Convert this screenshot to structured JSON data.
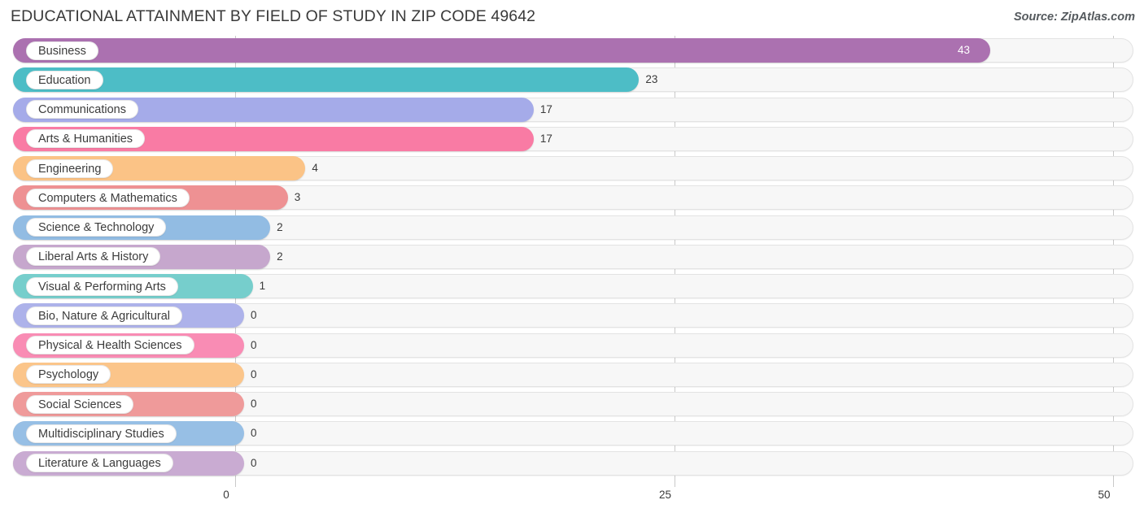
{
  "header": {
    "title": "EDUCATIONAL ATTAINMENT BY FIELD OF STUDY IN ZIP CODE 49642",
    "source": "Source: ZipAtlas.com"
  },
  "chart_data": {
    "type": "bar",
    "orientation": "horizontal",
    "title": "EDUCATIONAL ATTAINMENT BY FIELD OF STUDY IN ZIP CODE 49642",
    "xlabel": "",
    "ylabel": "",
    "xlim": [
      0,
      50
    ],
    "grid": true,
    "gridlines_at": [
      0,
      25,
      50
    ],
    "tick_labels": [
      "0",
      "25",
      "50"
    ],
    "legend": "none",
    "categories": [
      "Business",
      "Education",
      "Communications",
      "Arts & Humanities",
      "Engineering",
      "Computers & Mathematics",
      "Science & Technology",
      "Liberal Arts & History",
      "Visual & Performing Arts",
      "Bio, Nature & Agricultural",
      "Physical & Health Sciences",
      "Psychology",
      "Social Sciences",
      "Multidisciplinary Studies",
      "Literature & Languages"
    ],
    "values": [
      43,
      23,
      17,
      17,
      4,
      3,
      2,
      2,
      1,
      0,
      0,
      0,
      0,
      0,
      0
    ],
    "value_labels": [
      "43",
      "23",
      "17",
      "17",
      "4",
      "3",
      "2",
      "2",
      "1",
      "0",
      "0",
      "0",
      "0",
      "0",
      "0"
    ],
    "colors": [
      "#ab71b0",
      "#4dbdc6",
      "#a5abe9",
      "#f97ba4",
      "#fbc386",
      "#ee9193",
      "#92bce3",
      "#c6a7cd",
      "#76cecc",
      "#adb2ea",
      "#f98cb4",
      "#fbc58a",
      "#ef9a9a",
      "#97bfe5",
      "#c9abd2"
    ]
  },
  "axis": {
    "ticks": [
      {
        "label": "0",
        "value": 0
      },
      {
        "label": "25",
        "value": 25
      },
      {
        "label": "50",
        "value": 50
      }
    ]
  }
}
